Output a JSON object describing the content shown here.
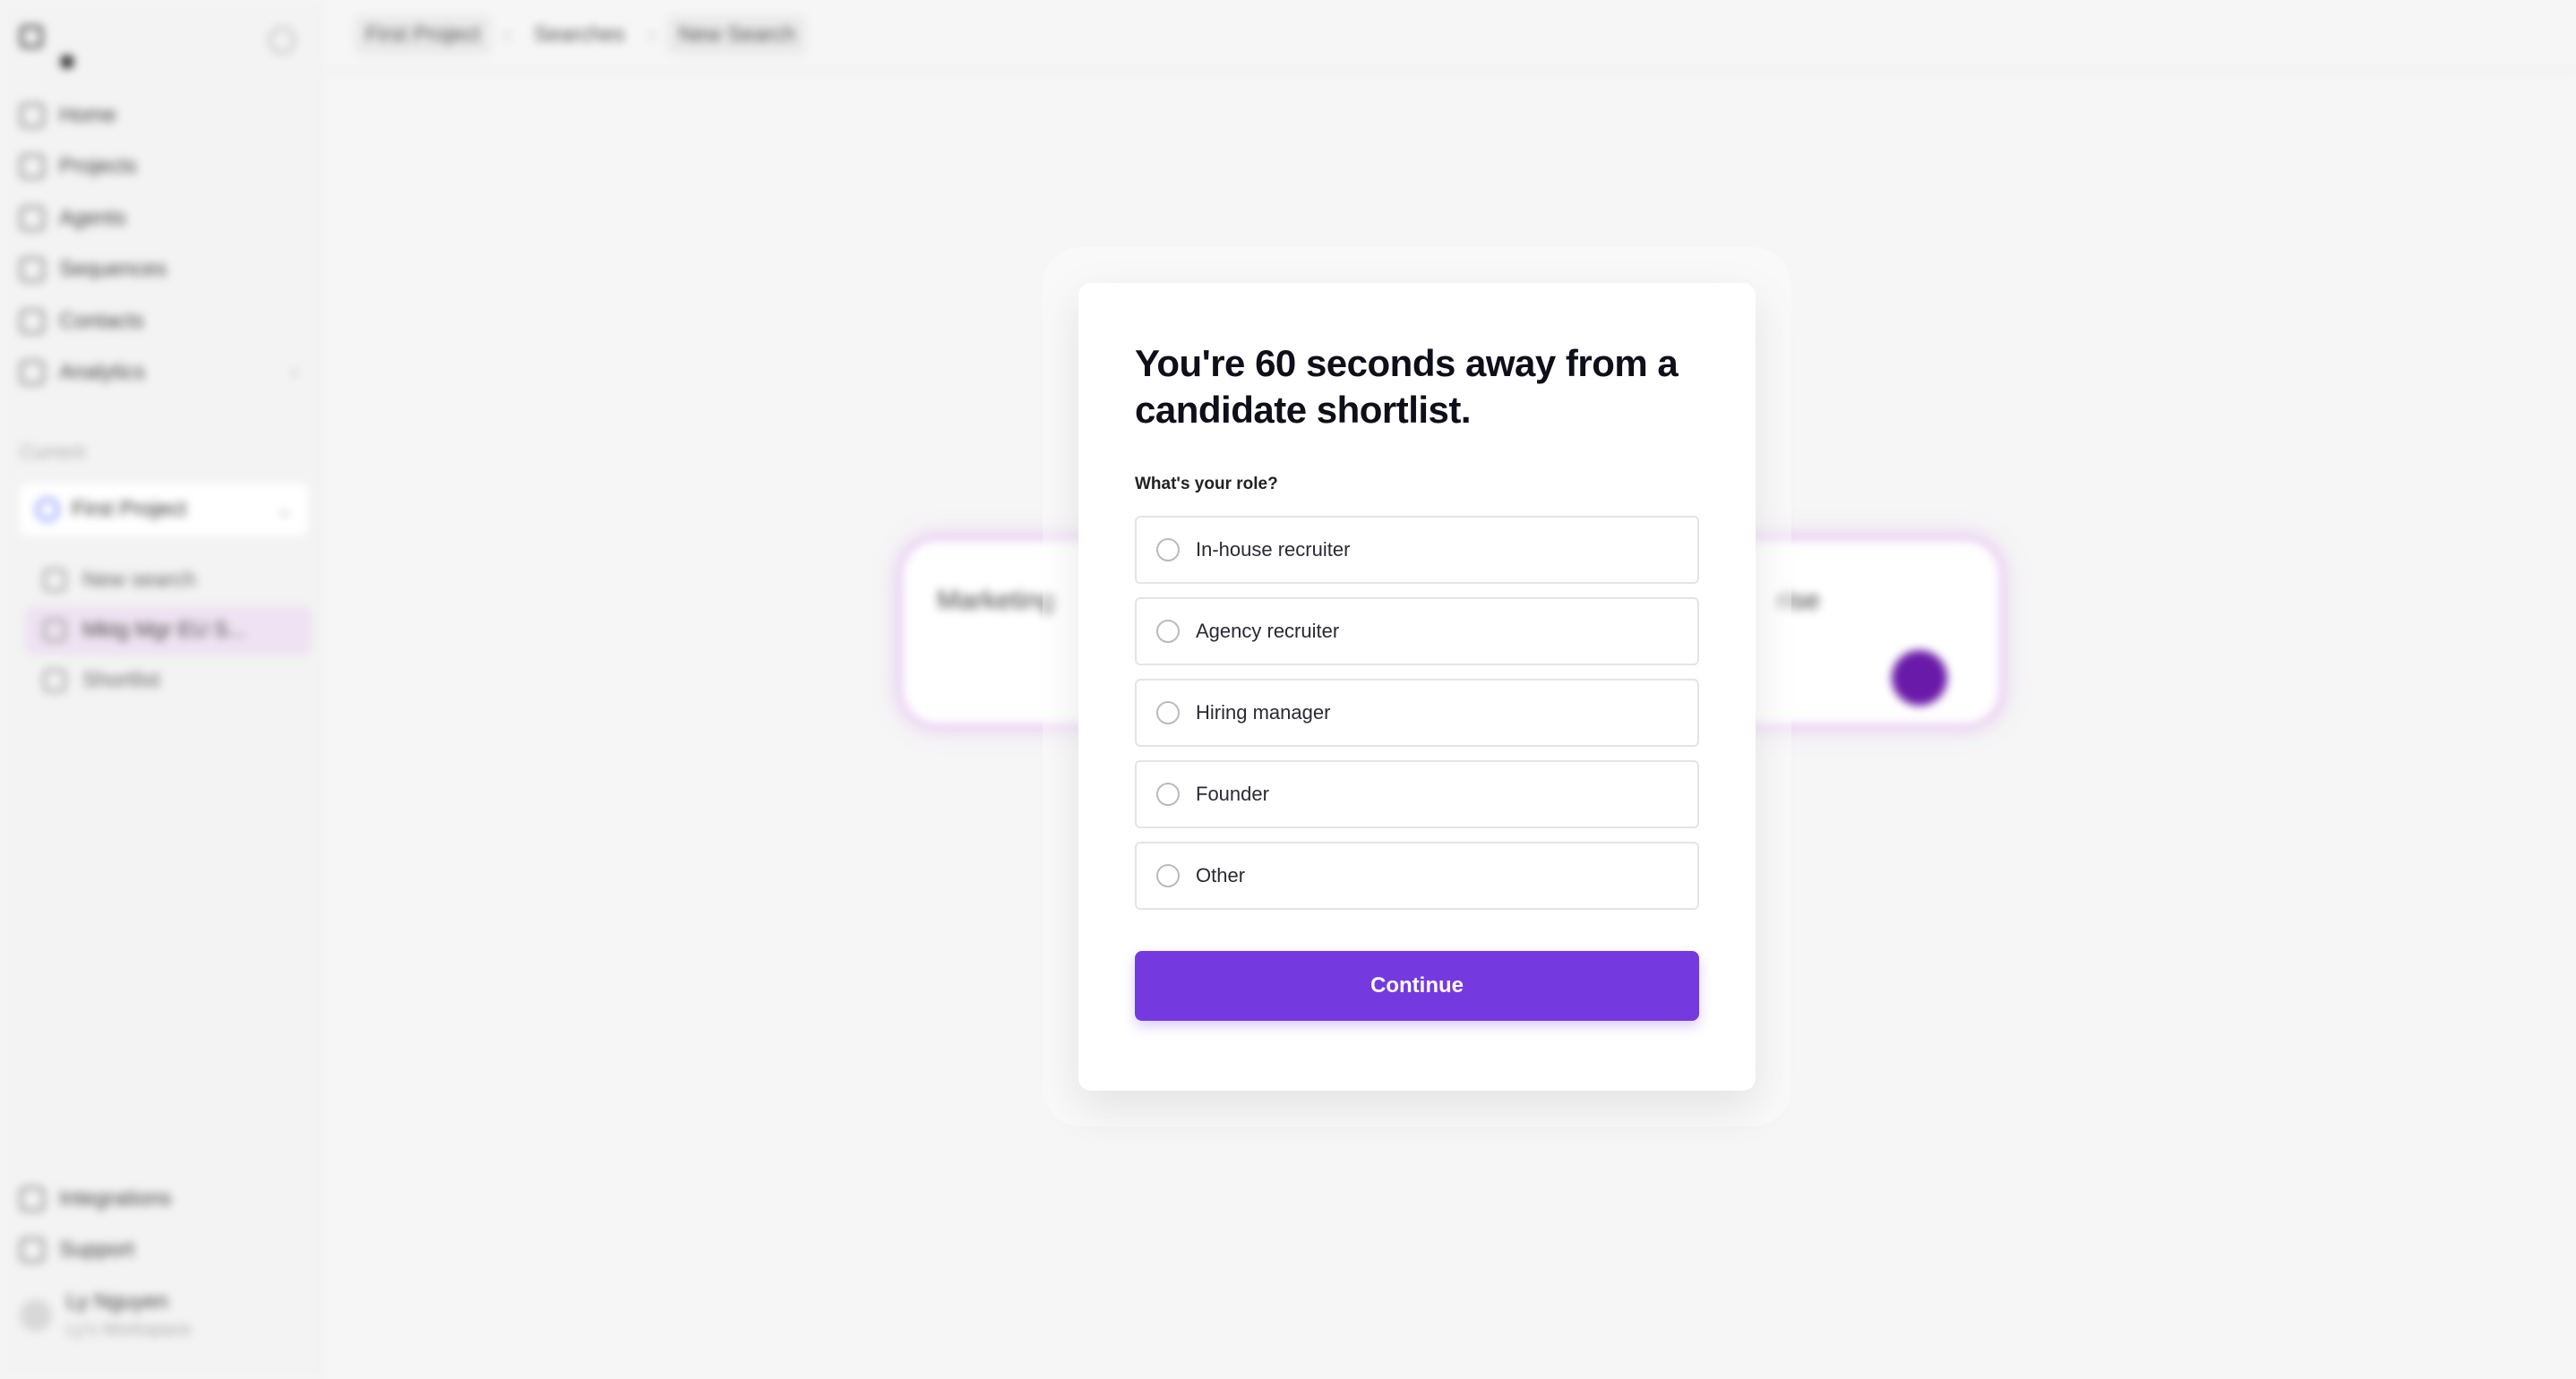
{
  "sidebar": {
    "nav": [
      {
        "label": "Home",
        "icon": "home-icon"
      },
      {
        "label": "Projects",
        "icon": "folder-icon"
      },
      {
        "label": "Agents",
        "icon": "agent-icon"
      },
      {
        "label": "Sequences",
        "icon": "sequence-icon"
      },
      {
        "label": "Contacts",
        "icon": "contacts-icon"
      },
      {
        "label": "Analytics",
        "icon": "analytics-icon"
      }
    ],
    "section_label": "Current",
    "project": "First Project",
    "sub_items": [
      {
        "label": "New search"
      },
      {
        "label": "Mktg Mgr EU S..."
      },
      {
        "label": "Shortlist"
      }
    ],
    "bottom_nav": [
      {
        "label": "Integrations"
      },
      {
        "label": "Support"
      }
    ],
    "user": {
      "name": "Ly Nguyen",
      "workspace": "Ly's Workspace"
    }
  },
  "topbar": {
    "crumbs": [
      "First Project",
      "Searches",
      "New Search"
    ]
  },
  "search_card": {
    "text_left": "Marketing",
    "text_right": "rise"
  },
  "modal": {
    "title": "You're 60 seconds away from a candidate shortlist.",
    "question": "What's your role?",
    "options": [
      {
        "label": "In-house recruiter"
      },
      {
        "label": "Agency recruiter"
      },
      {
        "label": "Hiring manager"
      },
      {
        "label": "Founder"
      },
      {
        "label": "Other"
      }
    ],
    "continue_label": "Continue"
  },
  "colors": {
    "accent": "#7539e0",
    "search_glow": "#eacdf2",
    "send_button": "#6a1aa8"
  }
}
